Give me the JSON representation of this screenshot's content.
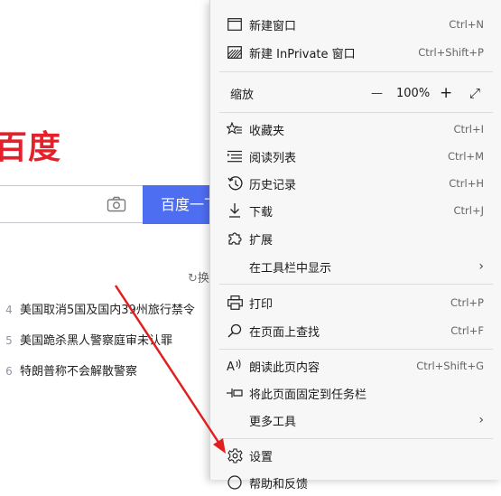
{
  "background": {
    "logo_text": "百度",
    "search_button_label": "百度一下",
    "refresh_label": "换",
    "hot_list": [
      {
        "rank": "4",
        "text": "美国取消5国及国内39州旅行禁令"
      },
      {
        "rank": "5",
        "text": "美国跪杀黑人警察庭审未认罪"
      },
      {
        "rank": "6",
        "text": "特朗普称不会解散警察"
      }
    ]
  },
  "menu": {
    "new_window": {
      "label": "新建窗口",
      "shortcut": "Ctrl+N"
    },
    "new_inprivate": {
      "label": "新建 InPrivate 窗口",
      "shortcut": "Ctrl+Shift+P"
    },
    "zoom": {
      "label": "缩放",
      "minus": "—",
      "value": "100%",
      "plus": "+",
      "fullscreen": "⤢"
    },
    "favorites": {
      "label": "收藏夹",
      "shortcut": "Ctrl+I"
    },
    "reading_list": {
      "label": "阅读列表",
      "shortcut": "Ctrl+M"
    },
    "history": {
      "label": "历史记录",
      "shortcut": "Ctrl+H"
    },
    "downloads": {
      "label": "下载",
      "shortcut": "Ctrl+J"
    },
    "extensions": {
      "label": "扩展"
    },
    "show_in_toolbar": {
      "label": "在工具栏中显示",
      "chevron": "›"
    },
    "print": {
      "label": "打印",
      "shortcut": "Ctrl+P"
    },
    "find": {
      "label": "在页面上查找",
      "shortcut": "Ctrl+F"
    },
    "read_aloud": {
      "label": "朗读此页内容",
      "shortcut": "Ctrl+Shift+G"
    },
    "pin_taskbar": {
      "label": "将此页面固定到任务栏"
    },
    "more_tools": {
      "label": "更多工具",
      "chevron": "›"
    },
    "settings": {
      "label": "设置"
    },
    "help_feedback": {
      "label": "帮助和反馈"
    }
  },
  "colors": {
    "accent": "#4e6ef2",
    "logo_red": "#e4202a",
    "arrow": "#e02020"
  }
}
